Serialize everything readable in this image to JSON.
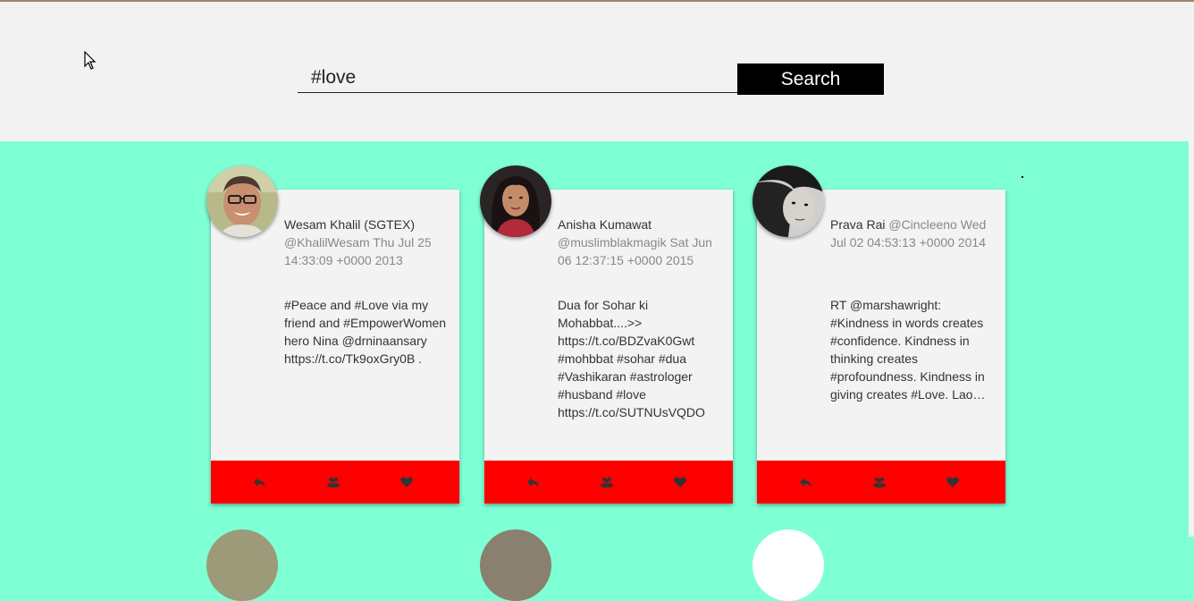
{
  "search": {
    "value": "#love",
    "button_label": "Search"
  },
  "colors": {
    "header_bg": "#f2f2f2",
    "feed_bg": "#7fffd4",
    "card_bg": "#f3f3f3",
    "action_bar": "#ff0000",
    "button_bg": "#000000"
  },
  "tweets": [
    {
      "name": "Wesam Khalil (SGTEX)",
      "handle": "@KhalilWesam",
      "date": "Thu Jul 25 14:33:09 +0000 2013",
      "text": "#Peace and #Love via my friend and #EmpowerWomen hero Nina @drninaansary https://t.co/Tk9oxGry0B ."
    },
    {
      "name": "Anisha Kumawat",
      "handle": "@muslimblakmagik",
      "date": "Sat Jun 06 12:37:15 +0000 2015",
      "text": "Dua for Sohar ki Mohabbat....>> https://t.co/BDZvaK0Gwt #mohbbat #sohar #dua #Vashikaran #astrologer #husband #love https://t.co/SUTNUsVQDO"
    },
    {
      "name": "Prava Rai",
      "handle": "@Cincleeno",
      "date": "Wed Jul 02 04:53:13 +0000 2014",
      "text": "RT @marshawright: #Kindness in words creates #confidence. Kindness in thinking creates #profoundness. Kindness in giving creates #Love. Lao…"
    }
  ],
  "icons": {
    "reply": "reply-icon",
    "retweet": "retweet-icon",
    "like": "heart-icon"
  }
}
